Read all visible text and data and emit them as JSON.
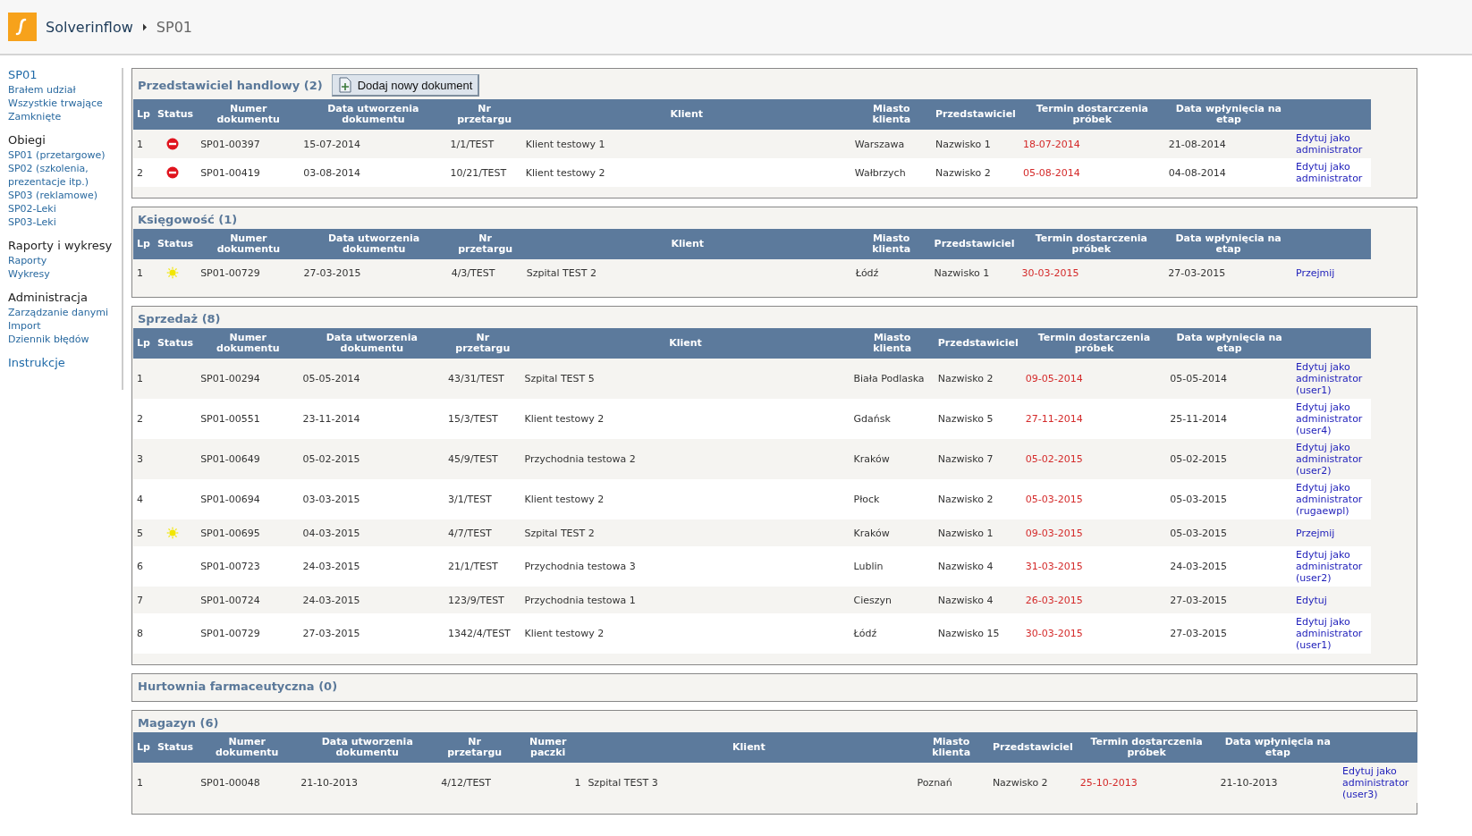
{
  "header": {
    "app_name": "Solverinflow",
    "breadcrumb": "SP01"
  },
  "sidebar": {
    "groups": [
      {
        "title": "SP01",
        "title_link": true,
        "items": [
          "Brałem udział",
          "Wszystkie trwające",
          "Zamknięte"
        ]
      },
      {
        "title": "Obiegi",
        "title_link": false,
        "items": [
          "SP01 (przetargowe)",
          "SP02 (szkolenia, prezentacje itp.)",
          "SP03 (reklamowe)",
          "SP02-Leki",
          "SP03-Leki"
        ]
      },
      {
        "title": "Raporty i wykresy",
        "title_link": false,
        "items": [
          "Raporty",
          "Wykresy"
        ]
      },
      {
        "title": "Administracja",
        "title_link": false,
        "items": [
          "Zarządzanie danymi",
          "Import",
          "Dziennik błędów"
        ]
      },
      {
        "title": "Instrukcje",
        "title_link": true
      }
    ]
  },
  "sections": [
    {
      "title": "Przedstawiciel handlowy (2)",
      "add_button": "Dodaj nowy dokument",
      "columns": [
        {
          "label": "Lp",
          "kind": "text"
        },
        {
          "label": "Status",
          "kind": "status"
        },
        {
          "label": "Numer dokumentu",
          "kind": "text"
        },
        {
          "label": "Data utworzenia dokumentu",
          "kind": "text"
        },
        {
          "label": "Nr przetargu",
          "kind": "text"
        },
        {
          "label": "Klient",
          "kind": "wide"
        },
        {
          "label": "Miasto klienta",
          "kind": "text"
        },
        {
          "label": "Przedstawiciel",
          "kind": "text"
        },
        {
          "label": "Termin dostarczenia próbek",
          "kind": "deadline"
        },
        {
          "label": "Data wpłynięcia na etap",
          "kind": "text"
        },
        {
          "kind": "action"
        }
      ],
      "rows": [
        {
          "kind": "blocked",
          "cells": [
            "1",
            "",
            "SP01-00397",
            "15-07-2014",
            "1/1/TEST",
            "Klient testowy 1",
            "Warszawa",
            "Nazwisko 1",
            "18-07-2014",
            "21-08-2014",
            "Edytuj jako administrator"
          ]
        },
        {
          "kind": "blocked",
          "cells": [
            "2",
            "",
            "SP01-00419",
            "03-08-2014",
            "10/21/TEST",
            "Klient testowy 2",
            "Wałbrzych",
            "Nazwisko 2",
            "05-08-2014",
            "04-08-2014",
            "Edytuj jako administrator"
          ]
        }
      ]
    },
    {
      "title": "Księgowość (1)",
      "columns": [
        {
          "label": "Lp",
          "kind": "text"
        },
        {
          "label": "Status",
          "kind": "status"
        },
        {
          "label": "Numer dokumentu",
          "kind": "text"
        },
        {
          "label": "Data utworzenia dokumentu",
          "kind": "text"
        },
        {
          "label": "Nr przetargu",
          "kind": "text"
        },
        {
          "label": "Klient",
          "kind": "wide"
        },
        {
          "label": "Miasto klienta",
          "kind": "text"
        },
        {
          "label": "Przedstawiciel",
          "kind": "text"
        },
        {
          "label": "Termin dostarczenia próbek",
          "kind": "deadline"
        },
        {
          "label": "Data wpłynięcia na etap",
          "kind": "text"
        },
        {
          "kind": "action"
        }
      ],
      "rows": [
        {
          "kind": "new",
          "cells": [
            "1",
            "",
            "SP01-00729",
            "27-03-2015",
            "4/3/TEST",
            "Szpital TEST 2",
            "Łódź",
            "Nazwisko 1",
            "30-03-2015",
            "27-03-2015",
            "Przejmij"
          ]
        }
      ]
    },
    {
      "title": "Sprzedaż (8)",
      "columns": [
        {
          "label": "Lp",
          "kind": "text"
        },
        {
          "label": "Status",
          "kind": "status"
        },
        {
          "label": "Numer dokumentu",
          "kind": "text"
        },
        {
          "label": "Data utworzenia dokumentu",
          "kind": "text"
        },
        {
          "label": "Nr przetargu",
          "kind": "text"
        },
        {
          "label": "Klient",
          "kind": "wide"
        },
        {
          "label": "Miasto klienta",
          "kind": "text"
        },
        {
          "label": "Przedstawiciel",
          "kind": "text"
        },
        {
          "label": "Termin dostarczenia próbek",
          "kind": "deadline"
        },
        {
          "label": "Data wpłynięcia na etap",
          "kind": "text"
        },
        {
          "kind": "action"
        }
      ],
      "rows": [
        {
          "kind": "plain",
          "cells": [
            "1",
            "",
            "SP01-00294",
            "05-05-2014",
            "43/31/TEST",
            "Szpital TEST 5",
            "Biała Podlaska",
            "Nazwisko 2",
            "09-05-2014",
            "05-05-2014",
            "Edytuj jako administrator (user1)"
          ]
        },
        {
          "kind": "plain",
          "cells": [
            "2",
            "",
            "SP01-00551",
            "23-11-2014",
            "15/3/TEST",
            "Klient testowy 2",
            "Gdańsk",
            "Nazwisko 5",
            "27-11-2014",
            "25-11-2014",
            "Edytuj jako administrator (user4)"
          ]
        },
        {
          "kind": "plain",
          "cells": [
            "3",
            "",
            "SP01-00649",
            "05-02-2015",
            "45/9/TEST",
            "Przychodnia testowa 2",
            "Kraków",
            "Nazwisko 7",
            "05-02-2015",
            "05-02-2015",
            "Edytuj jako administrator (user2)"
          ]
        },
        {
          "kind": "plain",
          "cells": [
            "4",
            "",
            "SP01-00694",
            "03-03-2015",
            "3/1/TEST",
            "Klient testowy 2",
            "Płock",
            "Nazwisko 2",
            "05-03-2015",
            "05-03-2015",
            "Edytuj jako administrator (rugaewpl)"
          ]
        },
        {
          "kind": "new",
          "cells": [
            "5",
            "",
            "SP01-00695",
            "04-03-2015",
            "4/7/TEST",
            "Szpital TEST 2",
            "Kraków",
            "Nazwisko 1",
            "09-03-2015",
            "05-03-2015",
            "Przejmij"
          ]
        },
        {
          "kind": "plain",
          "cells": [
            "6",
            "",
            "SP01-00723",
            "24-03-2015",
            "21/1/TEST",
            "Przychodnia testowa 3",
            "Lublin",
            "Nazwisko 4",
            "31-03-2015",
            "24-03-2015",
            "Edytuj jako administrator (user2)"
          ]
        },
        {
          "kind": "plain",
          "cells": [
            "7",
            "",
            "SP01-00724",
            "24-03-2015",
            "123/9/TEST",
            "Przychodnia testowa 1",
            "Cieszyn",
            "Nazwisko 4",
            "26-03-2015",
            "27-03-2015",
            "Edytuj"
          ]
        },
        {
          "kind": "plain",
          "cells": [
            "8",
            "",
            "SP01-00729",
            "27-03-2015",
            "1342/4/TEST",
            "Klient testowy 2",
            "Łódź",
            "Nazwisko 15",
            "30-03-2015",
            "27-03-2015",
            "Edytuj jako administrator (user1)"
          ]
        }
      ]
    },
    {
      "title": "Hurtownia farmaceutyczna (0)"
    },
    {
      "title": "Magazyn (6)",
      "columns": [
        {
          "label": "Lp",
          "kind": "text"
        },
        {
          "label": "Status",
          "kind": "status"
        },
        {
          "label": "Numer dokumentu",
          "kind": "text"
        },
        {
          "label": "Data utworzenia dokumentu",
          "kind": "text"
        },
        {
          "label": "Nr przetargu",
          "kind": "text"
        },
        {
          "label": "Numer paczki",
          "kind": "number"
        },
        {
          "label": "Klient",
          "kind": "wide"
        },
        {
          "label": "Miasto klienta",
          "kind": "text"
        },
        {
          "label": "Przedstawiciel",
          "kind": "text"
        },
        {
          "label": "Termin dostarczenia próbek",
          "kind": "deadline"
        },
        {
          "label": "Data wpłynięcia na etap",
          "kind": "text"
        },
        {
          "kind": "action"
        }
      ],
      "rows": [
        {
          "kind": "plain",
          "cells": [
            "1",
            "",
            "SP01-00048",
            "21-10-2013",
            "4/12/TEST",
            "1",
            "Szpital TEST 3",
            "Poznań",
            "Nazwisko 2",
            "25-10-2013",
            "21-10-2013",
            "Edytuj jako administrator (user3)"
          ]
        }
      ]
    }
  ]
}
